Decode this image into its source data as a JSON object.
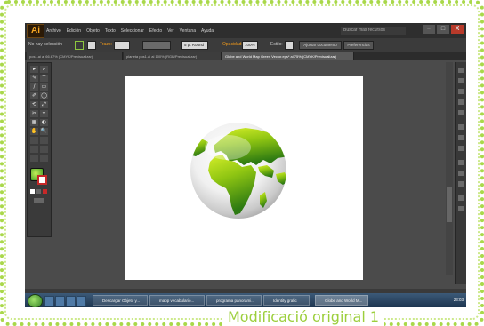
{
  "app": {
    "logo": "Ai",
    "menu": [
      "Archivo",
      "Edición",
      "Objeto",
      "Texto",
      "Seleccionar",
      "Efecto",
      "Ver",
      "Ventana",
      "Ayuda"
    ],
    "search_placeholder": "Buscar más recursos",
    "window_buttons": [
      "–",
      "□",
      "X"
    ]
  },
  "control_bar": {
    "selection_label": "No hay selección",
    "stroke_label": "Trazo:",
    "style_label": "Estilo:",
    "uniform_label": "Uniforme",
    "brush_value": "5 pt Round",
    "opacity_label": "Opacidad:",
    "opacity_value": "100%",
    "document_setup": "Ajustar documento",
    "preferences": "Preferencias"
  },
  "tabs": [
    {
      "label": "pos1.ai al 66.67% (CMYK/Previsualizar)",
      "active": false
    },
    {
      "label": "planeta pos1.ai al 100% (RGB/Previsualizar)",
      "active": false
    },
    {
      "label": "Globe and World Map Green Vector.eps* al 75% (CMYK/Previsualizar)",
      "active": true
    }
  ],
  "tools": [
    "▸",
    "▹",
    "✎",
    "T",
    "/",
    "▭",
    "✐",
    "◯",
    "⟲",
    "⤢",
    "✂",
    "⌖",
    "▦",
    "◐",
    "✋",
    "🔍"
  ],
  "taskbar": {
    "tasks": [
      {
        "label": "Descargar Objeto y...",
        "active": false
      },
      {
        "label": "mapp vecabulario...",
        "active": false
      },
      {
        "label": "programa panorami...",
        "active": false
      },
      {
        "label": "Identity grafic",
        "active": false
      },
      {
        "label": "Globe and World M...",
        "active": true
      }
    ],
    "clock": "23:03"
  },
  "caption": "Modificació original 1",
  "colors": {
    "accent_green": "#9ccf3c",
    "frame_green": "#a9d84a",
    "ui_dark": "#4b4b4b"
  }
}
